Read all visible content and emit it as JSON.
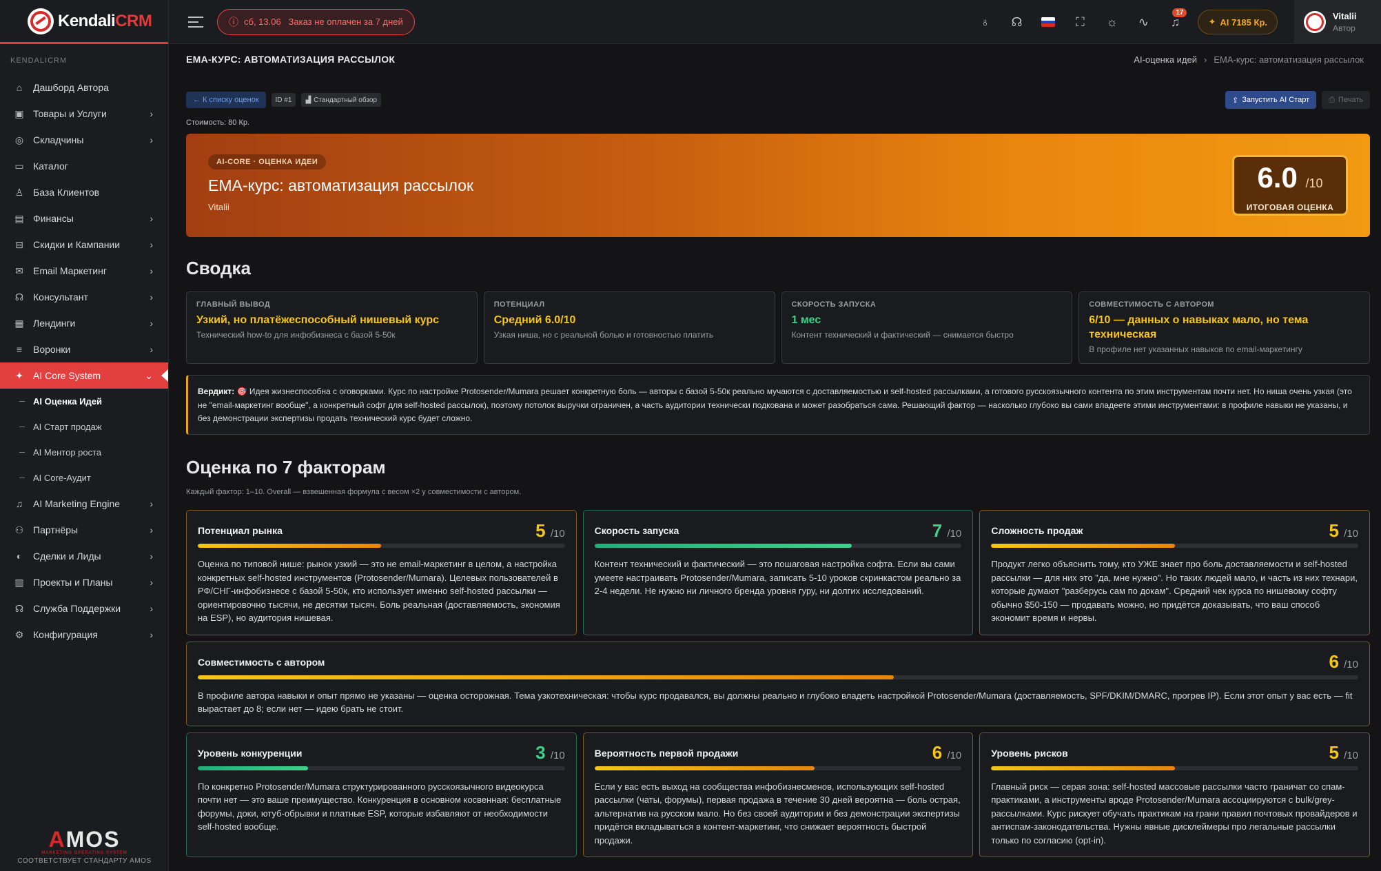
{
  "app": {
    "brand_main": "Kendali",
    "brand_accent": "CRM"
  },
  "sidebar": {
    "section": "KENDALICRM",
    "items": [
      {
        "label": "Дашборд Автора",
        "icon": "home-icon",
        "glyph": "⌂",
        "chevron": false
      },
      {
        "label": "Товары и Услуги",
        "icon": "box-icon",
        "glyph": "▣",
        "chevron": true
      },
      {
        "label": "Складчины",
        "icon": "globe-icon",
        "glyph": "◎",
        "chevron": true
      },
      {
        "label": "Каталог",
        "icon": "folder-icon",
        "glyph": "▭",
        "chevron": false
      },
      {
        "label": "База Клиентов",
        "icon": "user-icon",
        "glyph": "♙",
        "chevron": false
      },
      {
        "label": "Финансы",
        "icon": "wallet-icon",
        "glyph": "▤",
        "chevron": true
      },
      {
        "label": "Скидки и Кампании",
        "icon": "basket-icon",
        "glyph": "⊟",
        "chevron": true
      },
      {
        "label": "Email Маркетинг",
        "icon": "mail-icon",
        "glyph": "✉",
        "chevron": true
      },
      {
        "label": "Консультант",
        "icon": "headset-icon",
        "glyph": "☊",
        "chevron": true
      },
      {
        "label": "Лендинги",
        "icon": "page-icon",
        "glyph": "▦",
        "chevron": true
      },
      {
        "label": "Воронки",
        "icon": "filter-icon",
        "glyph": "≡",
        "chevron": true
      },
      {
        "label": "AI Core System",
        "icon": "sparkle-icon",
        "glyph": "✦",
        "chevron": true,
        "active": true
      }
    ],
    "sub_items": [
      {
        "label": "AI Оценка Идей",
        "active": true
      },
      {
        "label": "AI Старт продаж"
      },
      {
        "label": "AI Ментор роста"
      },
      {
        "label": "AI Core-Аудит"
      }
    ],
    "items_after": [
      {
        "label": "AI Marketing Engine",
        "icon": "bell-icon",
        "glyph": "♫",
        "chevron": true
      },
      {
        "label": "Партнёры",
        "icon": "people-icon",
        "glyph": "⚇",
        "chevron": true
      },
      {
        "label": "Сделки и Лиды",
        "icon": "deals-icon",
        "glyph": "◐",
        "chevron": true
      },
      {
        "label": "Проекты и Планы",
        "icon": "projects-icon",
        "glyph": "▥",
        "chevron": true
      },
      {
        "label": "Служба Поддержки",
        "icon": "support-icon",
        "glyph": "☊",
        "chevron": true
      },
      {
        "label": "Конфигурация",
        "icon": "gear-icon",
        "glyph": "⚙",
        "chevron": true
      }
    ],
    "footer": {
      "logo_a": "A",
      "logo_rest": "MOS",
      "tagline": "MARKETING OPERATING SYSTEM",
      "standard": "СООТВЕТСТВУЕТ СТАНДАРТУ AMOS"
    }
  },
  "header": {
    "alert": "сб, 13.06   Заказ не оплачен за 7 дней",
    "notifications": "17",
    "ai_credits": "AI 7185 Кр.",
    "user_name": "Vitalii",
    "user_role": "Автор"
  },
  "page": {
    "title": "EMA-КУРС: АВТОМАТИЗАЦИЯ РАССЫЛОК",
    "breadcrumb_root": "AI-оценка идей",
    "breadcrumb_current": "EMA-курс: автоматизация рассылок"
  },
  "toolbar": {
    "back": "← К списку оценок",
    "id_tag": "ID #1",
    "mode_tag": "Стандартный обзор",
    "run": "Запустить AI Старт",
    "print": "Печать"
  },
  "cost": "Стоимость: 80 Кр.",
  "hero": {
    "badge": "AI-CORE · ОЦЕНКА ИДЕИ",
    "title": "EMA-курс: автоматизация рассылок",
    "author": "Vitalii",
    "score": "6.0",
    "score_max": "/10",
    "score_label": "ИТОГОВАЯ ОЦЕНКА"
  },
  "summary": {
    "heading": "Сводка",
    "cards": [
      {
        "label": "ГЛАВНЫЙ ВЫВОД",
        "value": "Узкий, но платёжеспособный нишевый курс",
        "desc": "Технический how-to для инфобизнеса с базой 5-50к"
      },
      {
        "label": "ПОТЕНЦИАЛ",
        "value": "Средний 6.0/10",
        "desc": "Узкая ниша, но с реальной болью и готовностью платить"
      },
      {
        "label": "СКОРОСТЬ ЗАПУСКА",
        "value": "1 мес",
        "desc": "Контент технический и фактический — снимается быстро",
        "green": true
      },
      {
        "label": "СОВМЕСТИМОСТЬ С АВТОРОМ",
        "value": "6/10 — данных о навыках мало, но тема техническая",
        "desc": "В профиле нет указанных навыков по email-маркетингу"
      }
    ]
  },
  "verdict": {
    "label": "Вердикт:",
    "text": "🎯 Идея жизнеспособна с оговорками. Курс по настройке Protosender/Mumara решает конкретную боль — авторы с базой 5-50к реально мучаются с доставляемостью и self-hosted рассылками, а готового русскоязычного контента по этим инструментам почти нет. Но ниша очень узкая (это не \"email-маркетинг вообще\", а конкретный софт для self-hosted рассылок), поэтому потолок выручки ограничен, а часть аудитории технически подкована и может разобраться сама. Решающий фактор — насколько глубоко вы сами владеете этими инструментами: в профиле навыки не указаны, и без демонстрации экспертизы продать технический курс будет сложно."
  },
  "factors": {
    "heading": "Оценка по 7 факторам",
    "note": "Каждый фактор: 1–10. Overall — взвешенная формула с весом ×2 у совместимости с автором.",
    "max": "/10",
    "rows": [
      [
        {
          "title": "Потенциал рынка",
          "score": "5",
          "fill": 0.5,
          "tone": "warn",
          "desc": "Оценка по типовой нише: рынок узкий — это не email-маркетинг в целом, а настройка конкретных self-hosted инструментов (Protosender/Mumara). Целевых пользователей в РФ/СНГ-инфобизнесе с базой 5-50к, кто использует именно self-hosted рассылки — ориентировочно тысячи, не десятки тысяч. Боль реальная (доставляемость, экономия на ESP), но аудитория нишевая."
        },
        {
          "title": "Скорость запуска",
          "score": "7",
          "fill": 0.7,
          "tone": "good",
          "desc": "Контент технический и фактический — это пошаговая настройка софта. Если вы сами умеете настраивать Protosender/Mumara, записать 5-10 уроков скринкастом реально за 2-4 недели. Не нужно ни личного бренда уровня гуру, ни долгих исследований."
        },
        {
          "title": "Сложность продаж",
          "score": "5",
          "fill": 0.5,
          "tone": "warn",
          "desc": "Продукт легко объяснить тому, кто УЖЕ знает про боль доставляемости и self-hosted рассылки — для них это \"да, мне нужно\". Но таких людей мало, и часть из них технари, которые думают \"разберусь сам по докам\". Средний чек курса по нишевому софту обычно $50-150 — продавать можно, но придётся доказывать, что ваш способ экономит время и нервы."
        }
      ],
      [
        {
          "title": "Совместимость с автором",
          "score": "6",
          "fill": 0.6,
          "tone": "warn",
          "desc": "В профиле автора навыки и опыт прямо не указаны — оценка осторожная. Тема узкотехническая: чтобы курс продавался, вы должны реально и глубоко владеть настройкой Protosender/Mumara (доставляемость, SPF/DKIM/DMARC, прогрев IP). Если этот опыт у вас есть — fit вырастает до 8; если нет — идею брать не стоит."
        }
      ],
      [
        {
          "title": "Уровень конкуренции",
          "score": "3",
          "fill": 0.3,
          "tone": "good",
          "desc": "По конкретно Protosender/Mumara структурированного русскоязычного видеокурса почти нет — это ваше преимущество. Конкуренция в основном косвенная: бесплатные форумы, доки, ютуб-обрывки и платные ESP, которые избавляют от необходимости self-hosted вообще."
        },
        {
          "title": "Вероятность первой продажи",
          "score": "6",
          "fill": 0.6,
          "tone": "warn",
          "desc": "Если у вас есть выход на сообщества инфобизнесменов, использующих self-hosted рассылки (чаты, форумы), первая продажа в течение 30 дней вероятна — боль острая, альтернатив на русском мало. Но без своей аудитории и без демонстрации экспертизы придётся вкладываться в контент-маркетинг, что снижает вероятность быстрой продажи."
        },
        {
          "title": "Уровень рисков",
          "score": "5",
          "fill": 0.5,
          "tone": "warn",
          "desc": "Главный риск — серая зона: self-hosted массовые рассылки часто граничат со спам-практиками, а инструменты вроде Protosender/Mumara ассоциируются с bulk/grey-рассылками. Курс рискует обучать практикам на грани правил почтовых провайдеров и антиспам-законодательства. Нужны явные дисклеймеры про легальные рассылки только по согласию (opt-in)."
        }
      ]
    ]
  },
  "colors": {
    "accent": "#e43f3f",
    "warn": "#f5c518",
    "good": "#3cd28a"
  }
}
